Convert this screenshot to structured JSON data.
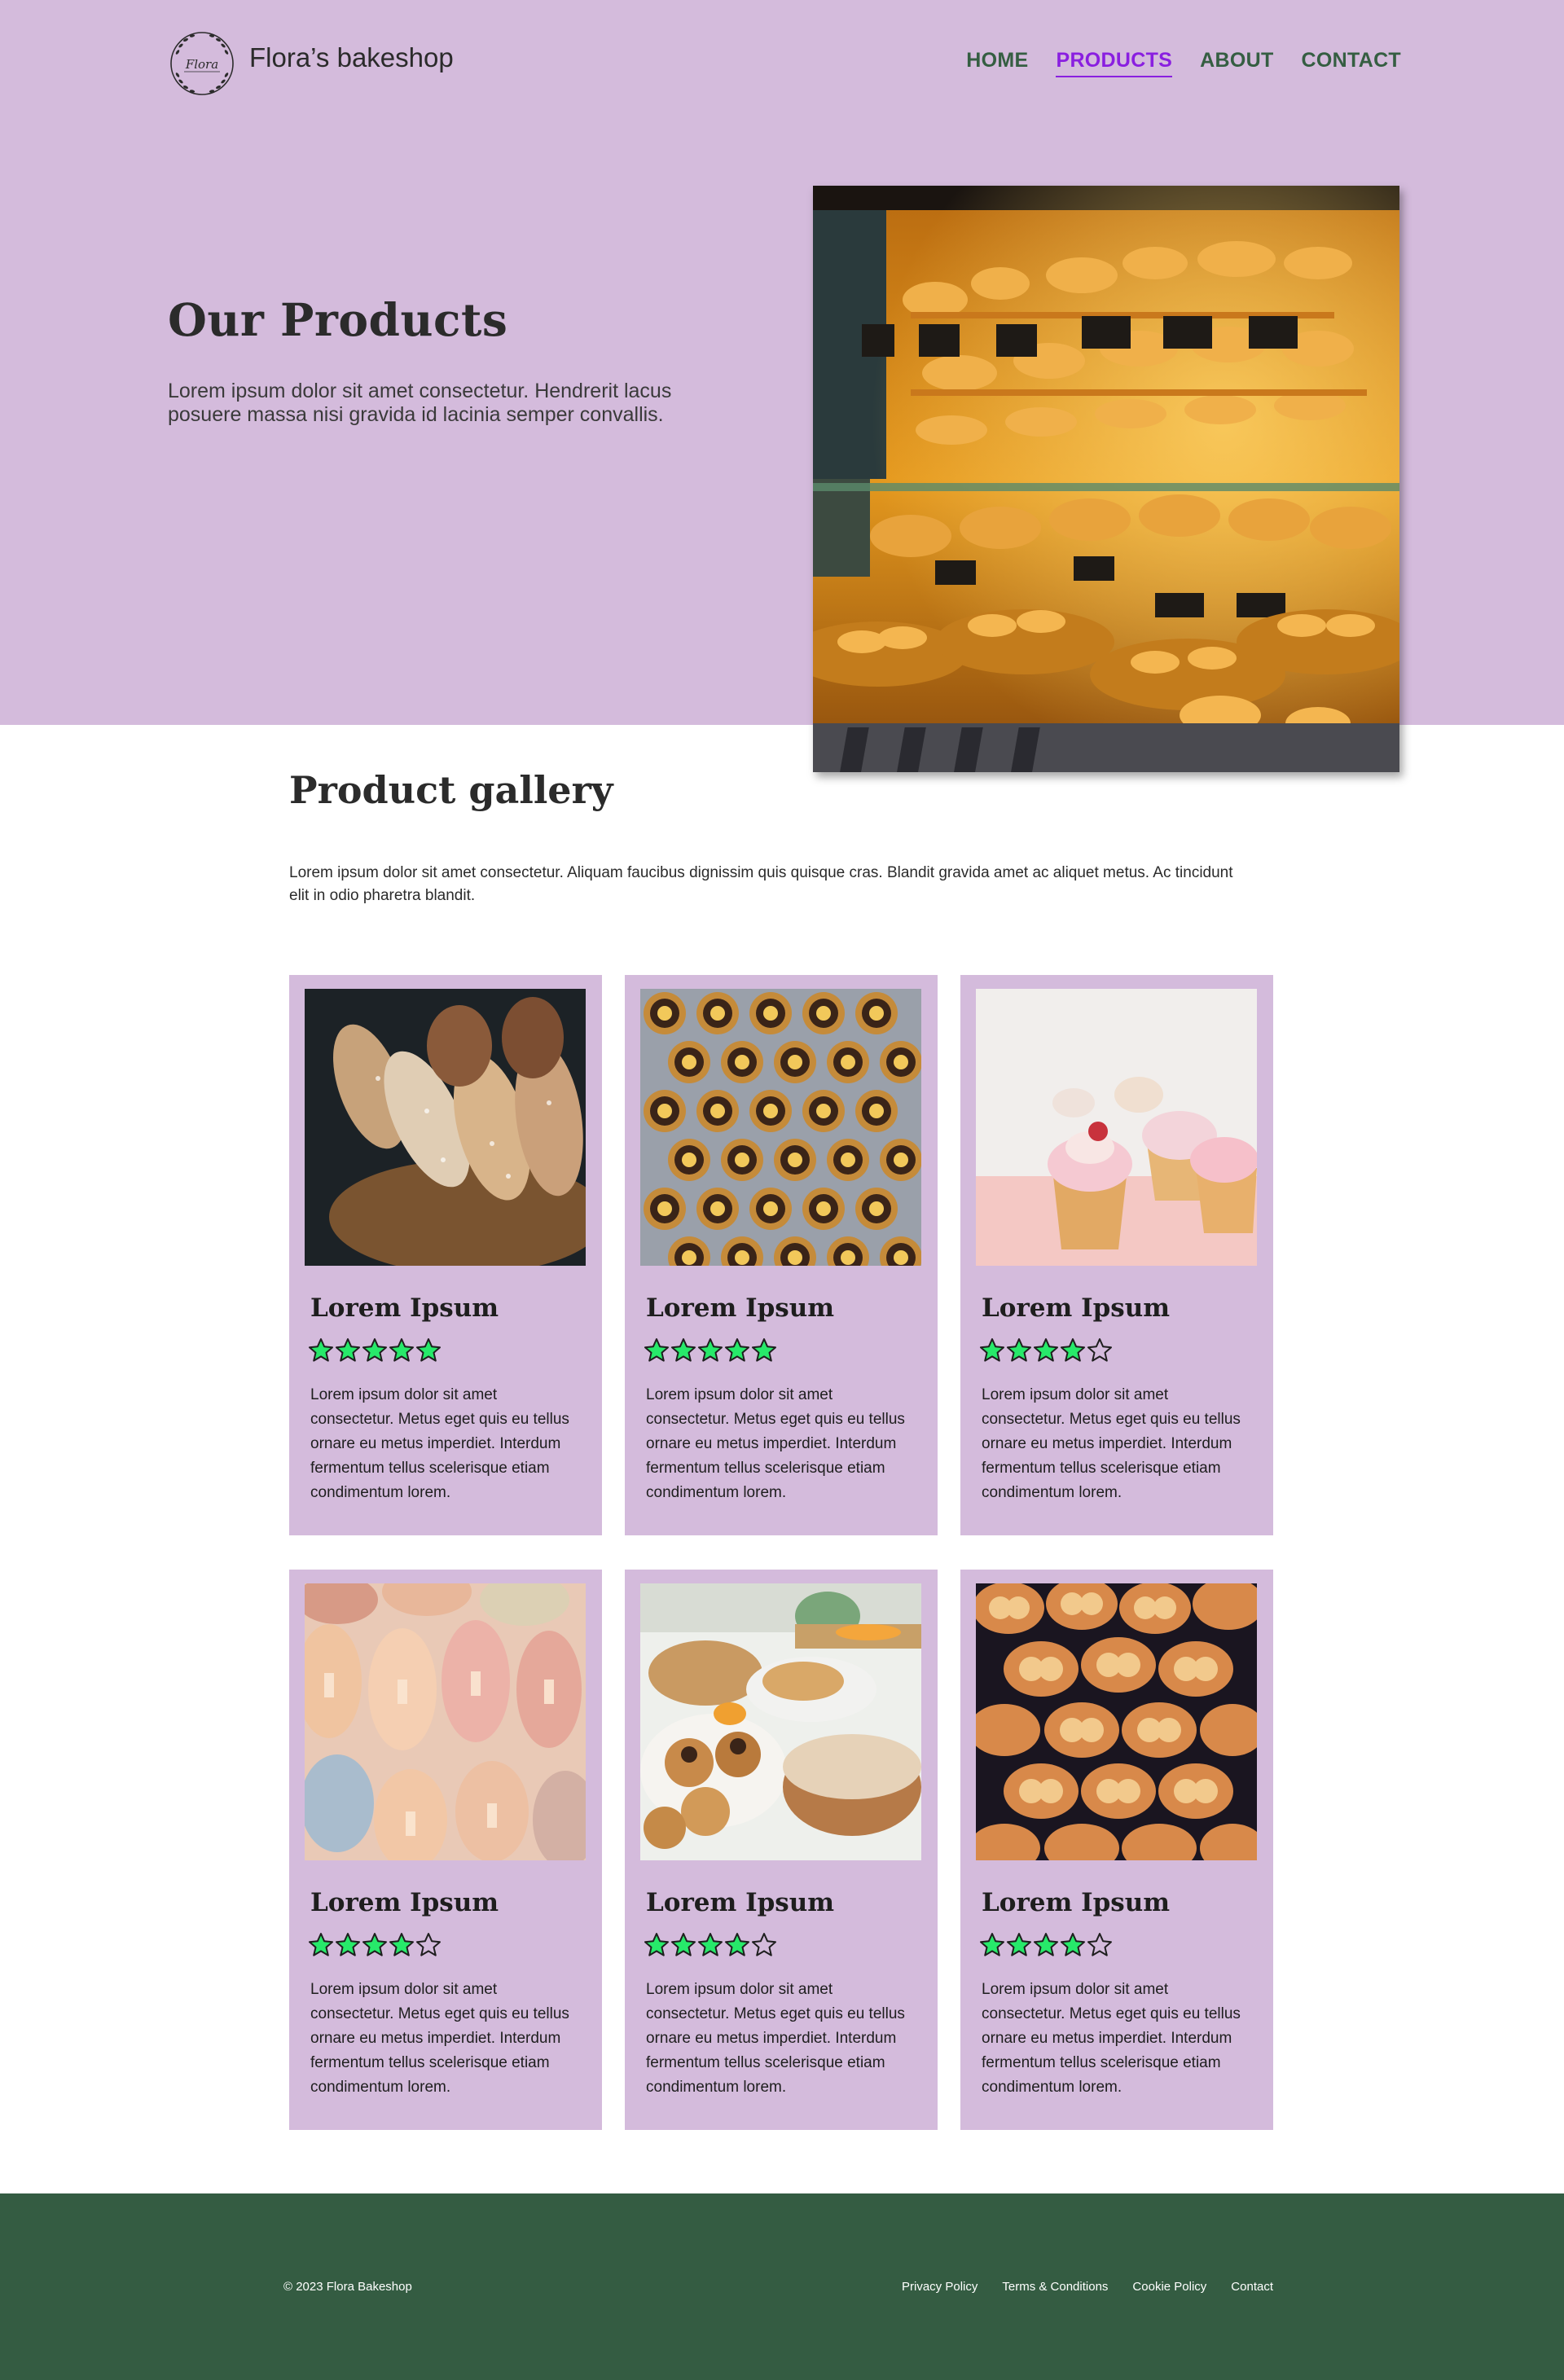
{
  "brand": {
    "name": "Flora’s bakeshop",
    "logo_text": "Flora"
  },
  "nav": {
    "items": [
      {
        "label": "HOME",
        "active": false
      },
      {
        "label": "PRODUCTS",
        "active": true
      },
      {
        "label": "ABOUT",
        "active": false
      },
      {
        "label": "CONTACT",
        "active": false
      }
    ]
  },
  "hero": {
    "title": "Our Products",
    "description": "Lorem ipsum dolor sit amet consectetur. Hendrerit lacus posuere massa nisi gravida id lacinia semper convallis.",
    "image": "bakery-display-case-photo"
  },
  "gallery": {
    "title": "Product gallery",
    "description": "Lorem ipsum dolor sit amet consectetur. Aliquam faucibus dignissim quis quisque cras. Blandit gravida amet ac aliquet metus. Ac tincidunt elit in odio pharetra blandit.",
    "products": [
      {
        "title": "Lorem Ipsum",
        "rating": 5,
        "max_rating": 5,
        "image": "bread-loaves-photo",
        "text": "Lorem ipsum dolor sit amet consectetur. Metus eget quis eu tellus ornare eu metus imperdiet. Interdum fermentum tellus scelerisque etiam condimentum lorem."
      },
      {
        "title": "Lorem Ipsum",
        "rating": 5,
        "max_rating": 5,
        "image": "star-tarts-photo",
        "text": "Lorem ipsum dolor sit amet consectetur. Metus eget quis eu tellus ornare eu metus imperdiet. Interdum fermentum tellus scelerisque etiam condimentum lorem."
      },
      {
        "title": "Lorem Ipsum",
        "rating": 4,
        "max_rating": 5,
        "image": "cupcakes-photo",
        "text": "Lorem ipsum dolor sit amet consectetur. Metus eget quis eu tellus ornare eu metus imperdiet. Interdum fermentum tellus scelerisque etiam condimentum lorem."
      },
      {
        "title": "Lorem Ipsum",
        "rating": 4,
        "max_rating": 5,
        "image": "macarons-photo",
        "text": "Lorem ipsum dolor sit amet consectetur. Metus eget quis eu tellus ornare eu metus imperdiet. Interdum fermentum tellus scelerisque etiam condimentum lorem."
      },
      {
        "title": "Lorem Ipsum",
        "rating": 4,
        "max_rating": 5,
        "image": "pastries-counter-photo",
        "text": "Lorem ipsum dolor sit amet consectetur. Metus eget quis eu tellus ornare eu metus imperdiet. Interdum fermentum tellus scelerisque etiam condimentum lorem."
      },
      {
        "title": "Lorem Ipsum",
        "rating": 4,
        "max_rating": 5,
        "image": "heart-palmiers-photo",
        "text": "Lorem ipsum dolor sit amet consectetur. Metus eget quis eu tellus ornare eu metus imperdiet. Interdum fermentum tellus scelerisque etiam condimentum lorem."
      }
    ]
  },
  "footer": {
    "copyright": "© 2023 Flora Bakeshop",
    "links": [
      "Privacy Policy",
      "Terms & Conditions",
      "Cookie Policy",
      "Contact"
    ]
  },
  "colors": {
    "lavender": "#d4bbdc",
    "nav_green": "#355e42",
    "active_purple": "#8a1fe0",
    "highlight_green": "#27e96a",
    "footer_green": "#345c42",
    "star_fill": "#27e96a"
  }
}
